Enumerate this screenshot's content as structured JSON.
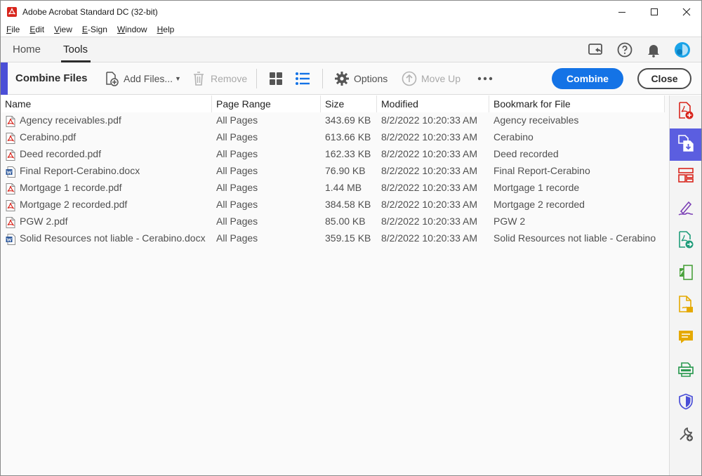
{
  "window": {
    "title": "Adobe Acrobat Standard DC (32-bit)"
  },
  "menu": [
    {
      "key": "F",
      "rest": "ile"
    },
    {
      "key": "E",
      "rest": "dit"
    },
    {
      "key": "V",
      "rest": "iew"
    },
    {
      "key": "E",
      "rest": "-Sign"
    },
    {
      "key": "W",
      "rest": "indow"
    },
    {
      "key": "H",
      "rest": "elp"
    }
  ],
  "tabs": {
    "home": "Home",
    "tools": "Tools"
  },
  "toolbar": {
    "title": "Combine Files",
    "add_files": "Add Files...",
    "remove": "Remove",
    "options": "Options",
    "move_up": "Move Up",
    "combine": "Combine",
    "close": "Close"
  },
  "table": {
    "columns": [
      "Name",
      "Page Range",
      "Size",
      "Modified",
      "Bookmark for File"
    ],
    "rows": [
      {
        "type": "pdf",
        "name": "Agency receivables.pdf",
        "range": "All Pages",
        "size": "343.69 KB",
        "modified": "8/2/2022 10:20:33 AM",
        "bookmark": "Agency receivables"
      },
      {
        "type": "pdf",
        "name": "Cerabino.pdf",
        "range": "All Pages",
        "size": "613.66 KB",
        "modified": "8/2/2022 10:20:33 AM",
        "bookmark": "Cerabino"
      },
      {
        "type": "pdf",
        "name": "Deed recorded.pdf",
        "range": "All Pages",
        "size": "162.33 KB",
        "modified": "8/2/2022 10:20:33 AM",
        "bookmark": "Deed recorded"
      },
      {
        "type": "docx",
        "name": "Final Report-Cerabino.docx",
        "range": "All Pages",
        "size": "76.90 KB",
        "modified": "8/2/2022 10:20:33 AM",
        "bookmark": "Final Report-Cerabino"
      },
      {
        "type": "pdf",
        "name": "Mortgage 1 recorde.pdf",
        "range": "All Pages",
        "size": "1.44 MB",
        "modified": "8/2/2022 10:20:33 AM",
        "bookmark": "Mortgage 1 recorde"
      },
      {
        "type": "pdf",
        "name": "Mortgage 2 recorded.pdf",
        "range": "All Pages",
        "size": "384.58 KB",
        "modified": "8/2/2022 10:20:33 AM",
        "bookmark": "Mortgage 2 recorded"
      },
      {
        "type": "pdf",
        "name": "PGW 2.pdf",
        "range": "All Pages",
        "size": "85.00 KB",
        "modified": "8/2/2022 10:20:33 AM",
        "bookmark": "PGW 2"
      },
      {
        "type": "docx",
        "name": "Solid Resources not liable - Cerabino.docx",
        "range": "All Pages",
        "size": "359.15 KB",
        "modified": "8/2/2022 10:20:33 AM",
        "bookmark": "Solid Resources not liable - Cerabino"
      }
    ]
  },
  "header_icons": [
    "share-screen-icon",
    "help-icon",
    "bell-icon",
    "profile-avatar-icon"
  ],
  "rail_icons": [
    "create-pdf-icon",
    "combine-files-icon",
    "organize-pages-icon",
    "fill-sign-icon",
    "export-pdf-icon",
    "edit-pdf-icon",
    "request-signature-icon",
    "comment-icon",
    "scan-ocr-icon",
    "protect-icon",
    "more-tools-icon"
  ],
  "colors": {
    "accent": "#4b4fd7",
    "primary_button": "#1473e6",
    "pdf_red": "#d8261d",
    "word_blue": "#2b579a"
  }
}
